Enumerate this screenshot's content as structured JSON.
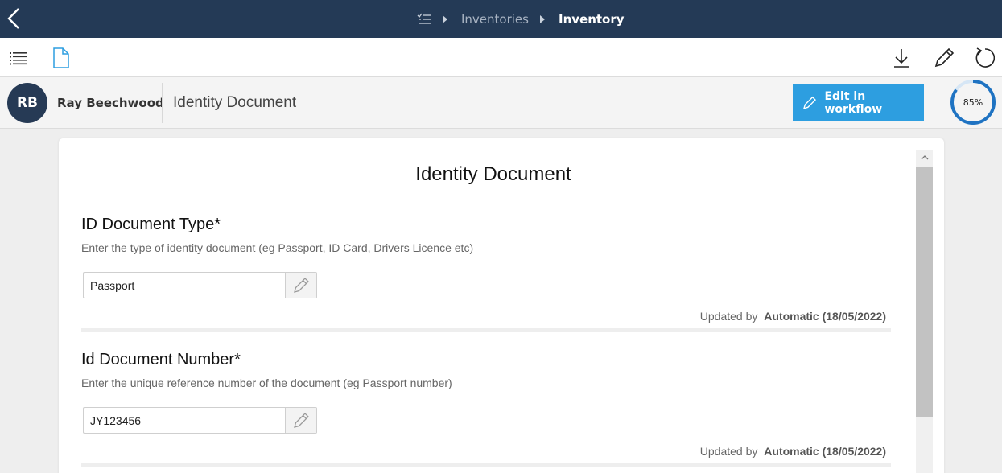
{
  "nav": {
    "breadcrumbs": [
      "Inventories",
      "Inventory"
    ]
  },
  "header": {
    "avatar_initials": "RB",
    "person_name": "Ray Beechwood",
    "document_title": "Identity Document",
    "edit_button_label": "Edit in workflow",
    "progress_label": "85%",
    "progress_value": 85
  },
  "form": {
    "title": "Identity Document",
    "fields": [
      {
        "label": "ID Document Type*",
        "help": "Enter the type of identity document (eg Passport, ID Card, Drivers Licence etc)",
        "value": "Passport",
        "updated_prefix": "Updated by",
        "updated_by": "Automatic (18/05/2022)"
      },
      {
        "label": "Id Document Number*",
        "help": "Enter the unique reference number of the document (eg Passport number)",
        "value": "JY123456",
        "updated_prefix": "Updated by",
        "updated_by": "Automatic (18/05/2022)"
      }
    ]
  },
  "colors": {
    "topbar": "#243a56",
    "accent": "#2d9ee0",
    "avatar": "#263a55",
    "progress": "#1f73c2"
  },
  "icons": {
    "back": "chevron-left-icon",
    "breadcrumb_root": "checklist-icon",
    "toolbar_left": [
      "list-icon",
      "document-icon"
    ],
    "toolbar_right": [
      "download-icon",
      "pencil-icon",
      "refresh-icon"
    ]
  }
}
